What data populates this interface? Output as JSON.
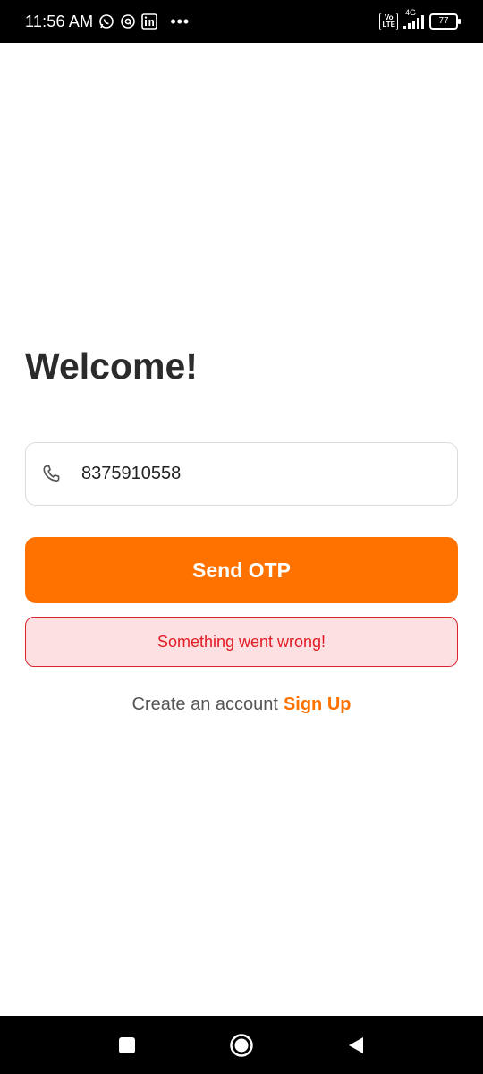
{
  "status_bar": {
    "time": "11:56 AM",
    "icons": [
      "whatsapp-icon",
      "at-sign-icon",
      "linkedin-icon",
      "more-dots-icon"
    ],
    "volte_label": "Vo\nLTE",
    "network": "4G",
    "battery": "77"
  },
  "login": {
    "title": "Welcome!",
    "phone_value": "8375910558",
    "phone_icon": "phone-icon",
    "send_button": "Send OTP",
    "error_message": "Something went wrong!",
    "signup_prompt": "Create an account",
    "signup_link": "Sign Up"
  },
  "nav_bar": {
    "buttons": [
      "recents-button",
      "home-button",
      "back-button"
    ]
  },
  "colors": {
    "accent": "#ff7200",
    "error_text": "#e21b23",
    "error_bg": "#fde0e2",
    "title": "#2b2b2b"
  }
}
